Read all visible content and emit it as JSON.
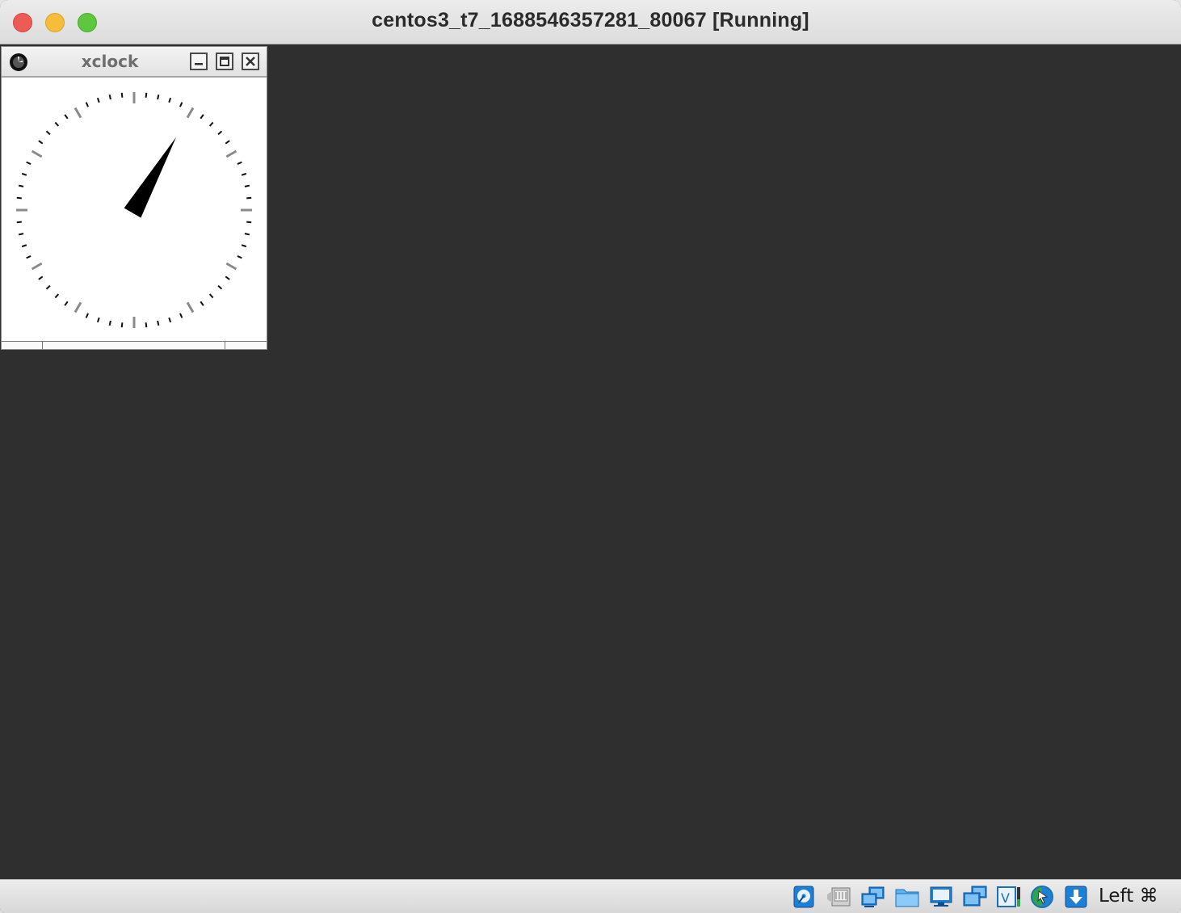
{
  "window": {
    "title": "centos3_t7_1688546357281_80067 [Running]",
    "buttons": {
      "close": "close",
      "minimize": "minimize",
      "zoom": "zoom"
    }
  },
  "guest": {
    "background_color": "#2f2f2f",
    "xclock": {
      "title": "xclock",
      "time": {
        "hour": 1,
        "minute": 5
      },
      "buttons": [
        "minimize",
        "maximize",
        "close"
      ]
    }
  },
  "statusbar": {
    "icons": [
      "hard-disk-icon",
      "optical-drive-icon",
      "network-icon",
      "shared-folders-icon",
      "display-icon",
      "video-capture-icon",
      "cpu-virtualization-icon",
      "mouse-integration-icon",
      "keyboard-capture-icon"
    ],
    "host_key": "Left ⌘"
  },
  "colors": {
    "traffic_close": "#ee5b54",
    "traffic_minimize": "#f6bd3b",
    "traffic_zoom": "#5fc73f",
    "vbox_blue": "#1e7fd6"
  }
}
